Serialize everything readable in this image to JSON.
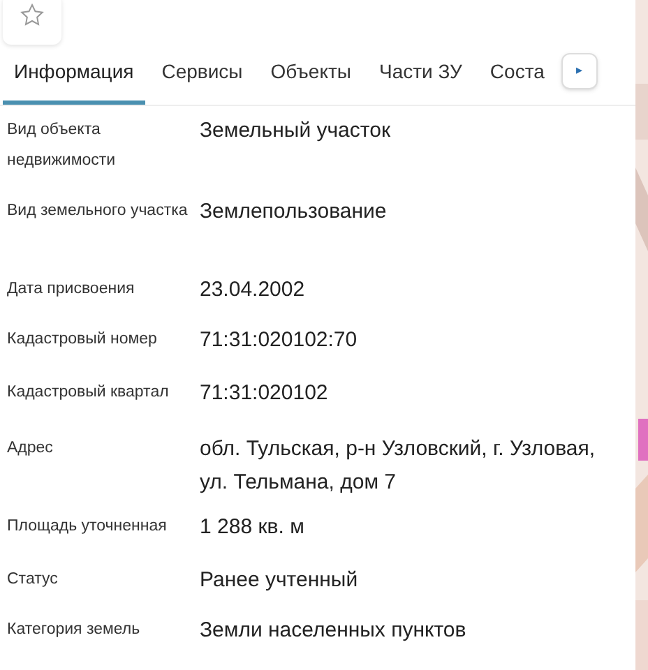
{
  "favorite": {
    "on": false
  },
  "tabs": [
    {
      "label": "Информация",
      "selected": true
    },
    {
      "label": "Сервисы",
      "selected": false
    },
    {
      "label": "Объекты",
      "selected": false
    },
    {
      "label": "Части ЗУ",
      "selected": false
    },
    {
      "label": "Соста",
      "selected": false
    }
  ],
  "tabs_scroll": {
    "label": "▸"
  },
  "fields": [
    {
      "label": "Вид объекта недвижимости",
      "value": "Земельный участок"
    },
    {
      "label": "Вид земельного участка",
      "value": "Землепользование"
    },
    {
      "label": "Дата присвоения",
      "value": "23.04.2002"
    },
    {
      "label": "Кадастровый номер",
      "value": "71:31:020102:70"
    },
    {
      "label": "Кадастровый квартал",
      "value": "71:31:020102"
    },
    {
      "label": "Адрес",
      "value": "обл. Тульская, р-н Узловский, г. Узловая, ул. Тельмана, дом 7"
    },
    {
      "label": "Площадь уточненная",
      "value": "1 288 кв. м"
    },
    {
      "label": "Статус",
      "value": "Ранее учтенный"
    },
    {
      "label": "Категория земель",
      "value": "Земли населенных пунктов"
    }
  ]
}
